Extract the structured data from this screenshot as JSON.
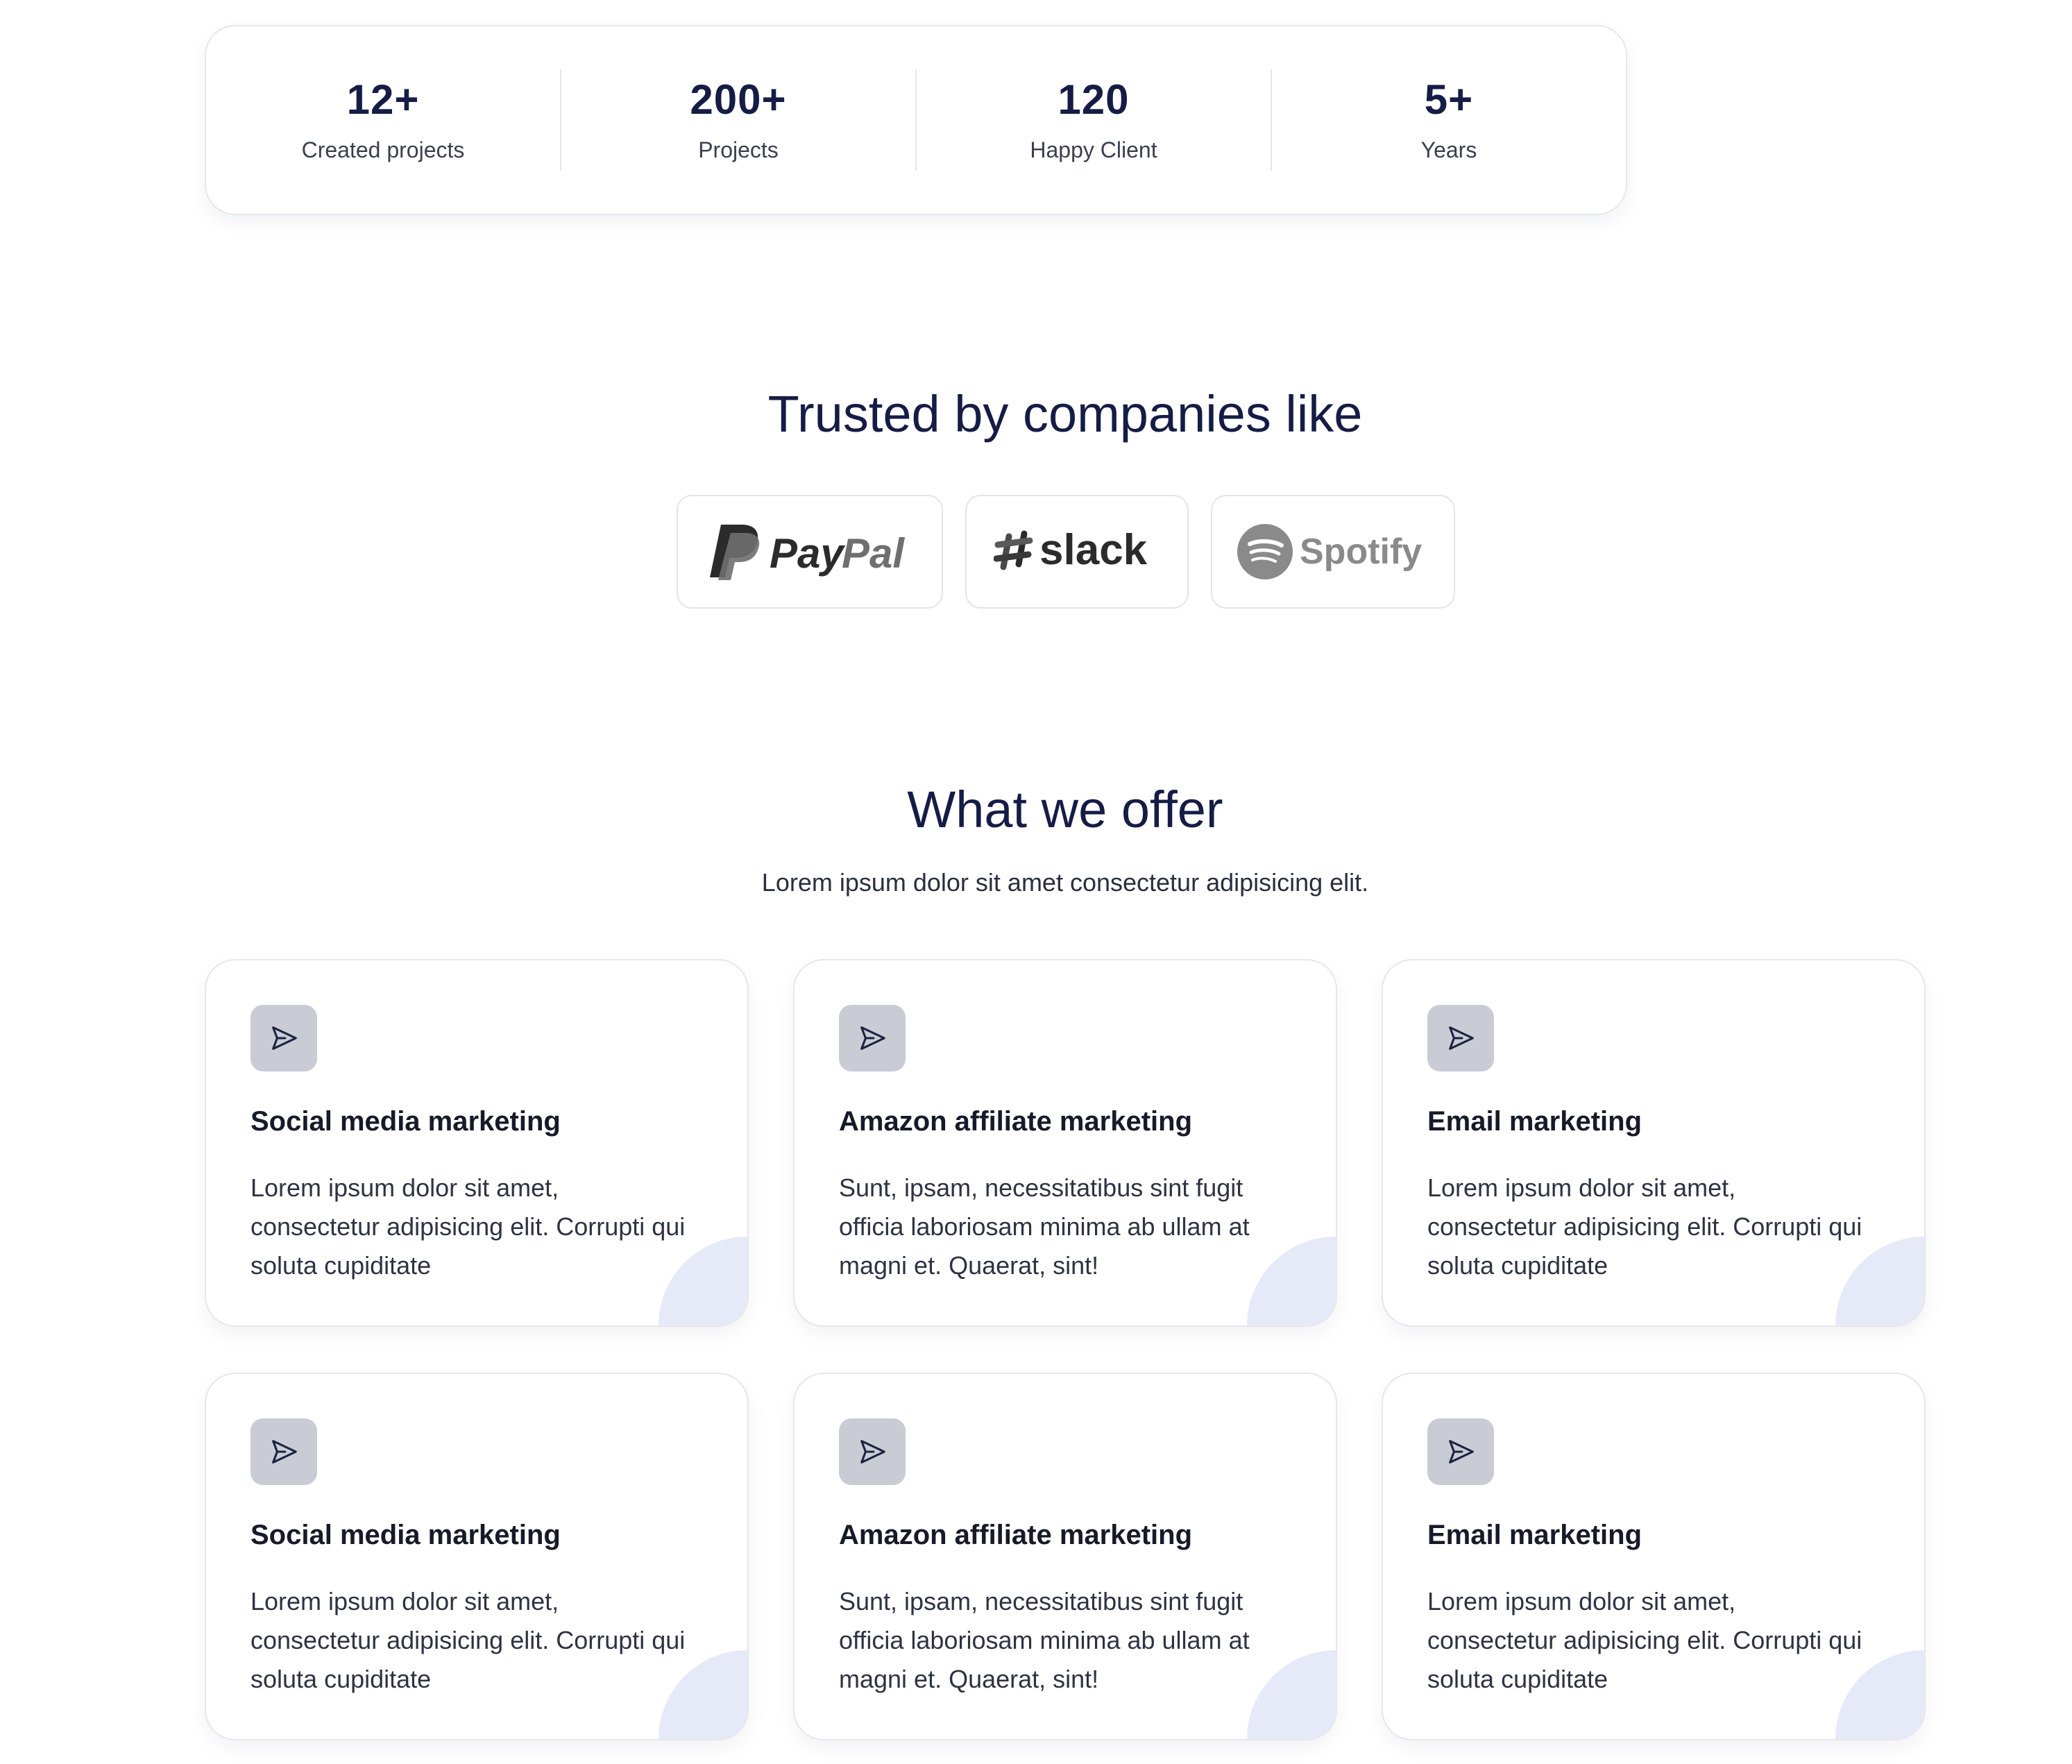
{
  "stats": [
    {
      "value": "12+",
      "label": "Created projects"
    },
    {
      "value": "200+",
      "label": "Projects"
    },
    {
      "value": "120",
      "label": "Happy Client"
    },
    {
      "value": "5+",
      "label": "Years"
    }
  ],
  "trusted": {
    "title": "Trusted by companies like",
    "logos": [
      {
        "icon": "paypal-logo",
        "text": "PayPal"
      },
      {
        "icon": "slack-logo",
        "text": "slack"
      },
      {
        "icon": "spotify-logo",
        "text": "Spotify"
      }
    ]
  },
  "offer": {
    "title": "What we offer",
    "subtitle": "Lorem ipsum dolor sit amet consectetur adipisicing elit.",
    "cards": [
      {
        "icon": "send-icon",
        "title": "Social media marketing",
        "desc": "Lorem ipsum dolor sit amet, consectetur adipisicing elit. Corrupti qui soluta cupiditate"
      },
      {
        "icon": "send-icon",
        "title": "Amazon affiliate marketing",
        "desc": "Sunt, ipsam, necessitatibus sint fugit officia laboriosam minima ab ullam at magni et. Quaerat, sint!"
      },
      {
        "icon": "send-icon",
        "title": "Email marketing",
        "desc": "Lorem ipsum dolor sit amet, consectetur adipisicing elit. Corrupti qui soluta cupiditate"
      },
      {
        "icon": "send-icon",
        "title": "Social media marketing",
        "desc": "Lorem ipsum dolor sit amet, consectetur adipisicing elit. Corrupti qui soluta cupiditate"
      },
      {
        "icon": "send-icon",
        "title": "Amazon affiliate marketing",
        "desc": "Sunt, ipsam, necessitatibus sint fugit officia laboriosam minima ab ullam at magni et. Quaerat, sint!"
      },
      {
        "icon": "send-icon",
        "title": "Email marketing",
        "desc": "Lorem ipsum dolor sit amet, consectetur adipisicing elit. Corrupti qui soluta cupiditate"
      }
    ]
  },
  "colors": {
    "heading": "#151c45",
    "card_border": "#e6e7ec",
    "icon_bg": "#c9ccd5",
    "card_accent": "#e6e9f8"
  }
}
